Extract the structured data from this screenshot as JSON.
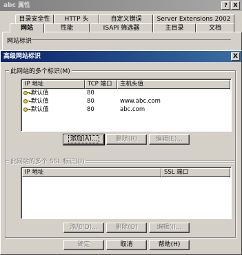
{
  "outer": {
    "title": "abc 属性",
    "help_btn": "?",
    "close_btn": "X",
    "tabs_row1": [
      "目录安全性",
      "HTTP 头",
      "自定义错误",
      "Server Extensions 2002"
    ],
    "tabs_row2": [
      "网站",
      "性能",
      "ISAPI 筛选器",
      "主目录",
      "文档"
    ],
    "group_label": "网站标识"
  },
  "dialog": {
    "title": "高级网站标识",
    "close_btn": "X",
    "identities": {
      "label": "此网站的多个标识(M)",
      "columns": [
        "IP 地址",
        "TCP 端口",
        "主机头值"
      ],
      "rows": [
        {
          "ip": "默认值",
          "port": "80",
          "host": ""
        },
        {
          "ip": "默认值",
          "port": "80",
          "host": "www.abc.com"
        },
        {
          "ip": "默认值",
          "port": "80",
          "host": "abc.com"
        }
      ],
      "add": "添加(A)...",
      "remove": "删除(R)",
      "edit": "编辑(E)..."
    },
    "ssl": {
      "label": "此网站的多个 SSL 标识(U)",
      "columns": [
        "IP 地址",
        "SSL 端口"
      ],
      "add": "添加(D)...",
      "remove": "删除(O)",
      "edit": "编辑(I)..."
    },
    "ok": "确定",
    "cancel": "取消",
    "help": "帮助(H)"
  }
}
